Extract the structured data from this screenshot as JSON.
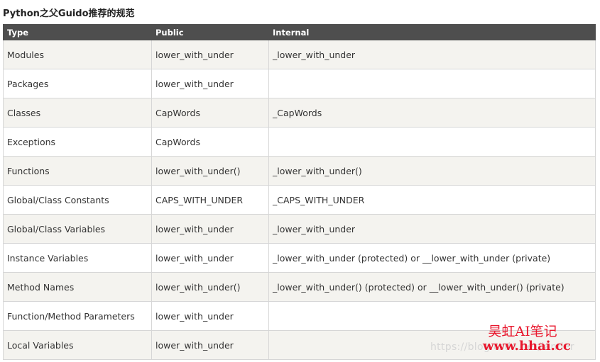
{
  "page": {
    "title": "Python之父Guido推荐的规范"
  },
  "table": {
    "headers": [
      "Type",
      "Public",
      "Internal"
    ],
    "rows": [
      {
        "type": "Modules",
        "public": "lower_with_under",
        "internal": "_lower_with_under"
      },
      {
        "type": "Packages",
        "public": "lower_with_under",
        "internal": ""
      },
      {
        "type": "Classes",
        "public": "CapWords",
        "internal": "_CapWords"
      },
      {
        "type": "Exceptions",
        "public": "CapWords",
        "internal": ""
      },
      {
        "type": "Functions",
        "public": "lower_with_under()",
        "internal": "_lower_with_under()"
      },
      {
        "type": "Global/Class Constants",
        "public": "CAPS_WITH_UNDER",
        "internal": "_CAPS_WITH_UNDER"
      },
      {
        "type": "Global/Class Variables",
        "public": "lower_with_under",
        "internal": "_lower_with_under"
      },
      {
        "type": "Instance Variables",
        "public": "lower_with_under",
        "internal": "_lower_with_under (protected) or __lower_with_under (private)"
      },
      {
        "type": "Method Names",
        "public": "lower_with_under()",
        "internal": "_lower_with_under() (protected) or __lower_with_under() (private)"
      },
      {
        "type": "Function/Method Parameters",
        "public": "lower_with_under",
        "internal": ""
      },
      {
        "type": "Local Variables",
        "public": "lower_with_under",
        "internal": ""
      }
    ]
  },
  "watermark": {
    "text": "https://blog.csdn.net/lander"
  },
  "stamp": {
    "line1": "昊虹AI笔记",
    "line2": "www.hhai.cc"
  },
  "colors": {
    "header_bg": "#4e4e4e",
    "row_alt_bg": "#f4f3ef",
    "stamp_red": "#e8172d"
  }
}
